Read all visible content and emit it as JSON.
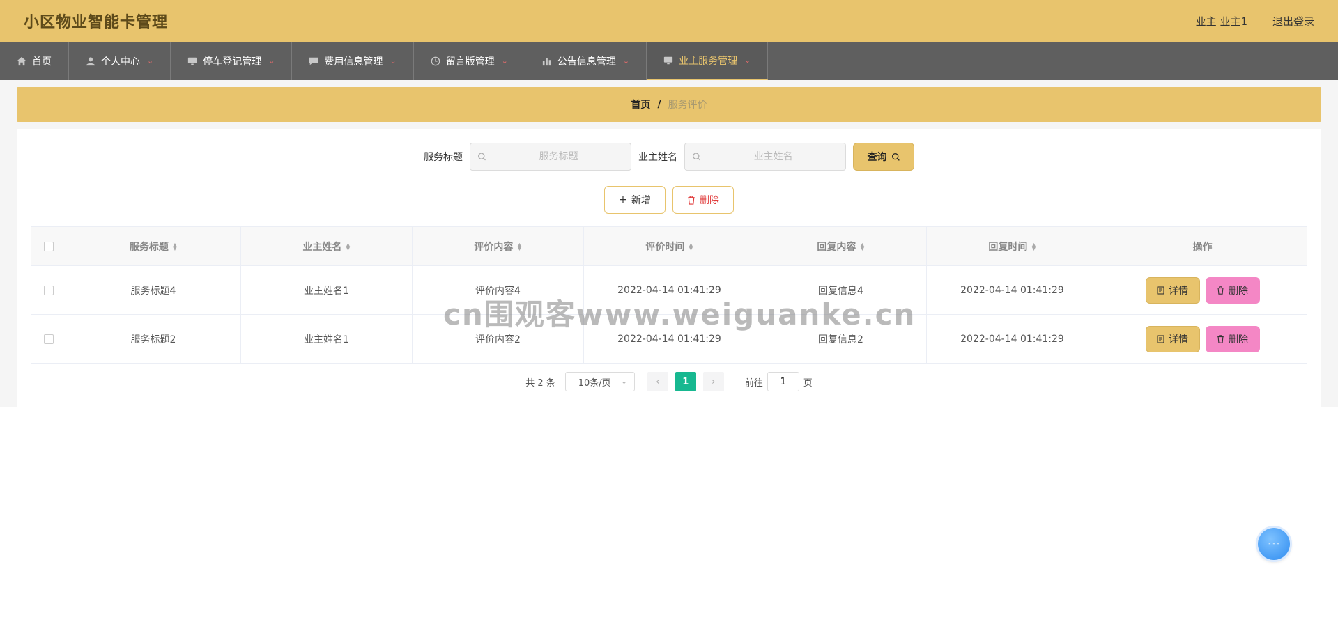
{
  "header": {
    "title": "小区物业智能卡管理",
    "user_label": "业主 业主1",
    "logout_label": "退出登录"
  },
  "nav": {
    "items": [
      {
        "label": "首页",
        "icon": "home-icon",
        "has_caret": false
      },
      {
        "label": "个人中心",
        "icon": "user-icon",
        "has_caret": true
      },
      {
        "label": "停车登记管理",
        "icon": "monitor-icon",
        "has_caret": true
      },
      {
        "label": "费用信息管理",
        "icon": "message-icon",
        "has_caret": true
      },
      {
        "label": "留言版管理",
        "icon": "clock-icon",
        "has_caret": true
      },
      {
        "label": "公告信息管理",
        "icon": "chart-icon",
        "has_caret": true
      },
      {
        "label": "业主服务管理",
        "icon": "monitor-icon",
        "has_caret": true,
        "active": true
      }
    ]
  },
  "breadcrumb": {
    "home": "首页",
    "separator": "/",
    "current": "服务评价"
  },
  "search": {
    "title_label": "服务标题",
    "title_placeholder": "服务标题",
    "owner_label": "业主姓名",
    "owner_placeholder": "业主姓名",
    "query_label": "查询"
  },
  "actions": {
    "add_label": "新增",
    "delete_label": "删除"
  },
  "table": {
    "columns": [
      "服务标题",
      "业主姓名",
      "评价内容",
      "评价时间",
      "回复内容",
      "回复时间",
      "操作"
    ],
    "rows": [
      {
        "title": "服务标题4",
        "owner": "业主姓名1",
        "content": "评价内容4",
        "time": "2022-04-14 01:41:29",
        "reply": "回复信息4",
        "reply_time": "2022-04-14 01:41:29"
      },
      {
        "title": "服务标题2",
        "owner": "业主姓名1",
        "content": "评价内容2",
        "time": "2022-04-14 01:41:29",
        "reply": "回复信息2",
        "reply_time": "2022-04-14 01:41:29"
      }
    ],
    "detail_label": "详情",
    "delete_label": "删除"
  },
  "pagination": {
    "total": "共 2 条",
    "page_size": "10条/页",
    "current_page": "1",
    "goto_label": "前往",
    "goto_value": "1",
    "page_unit": "页"
  },
  "watermark": "cn围观客www.weiguanke.cn",
  "colors": {
    "brand": "#e8c46d",
    "nav_bg": "#5f5f5f",
    "active_page": "#17b890",
    "danger_btn": "#f487c5"
  }
}
